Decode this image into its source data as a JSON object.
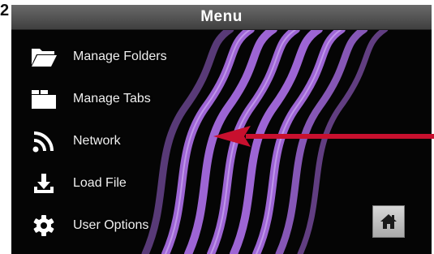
{
  "step_number": "2",
  "window": {
    "title": "Menu"
  },
  "menu": {
    "items": [
      {
        "label": "Manage Folders",
        "icon": "folder-open-icon"
      },
      {
        "label": "Manage Tabs",
        "icon": "tabs-icon"
      },
      {
        "label": "Network",
        "icon": "wifi-icon"
      },
      {
        "label": "Load File",
        "icon": "download-icon"
      },
      {
        "label": "User Options",
        "icon": "gear-icon"
      }
    ]
  },
  "home_button": {
    "icon": "home-icon"
  },
  "annotation": {
    "target": "Network",
    "color": "#c8102e"
  },
  "colors": {
    "background": "#050505",
    "wave": "#a66be0",
    "arrow": "#c8102e"
  }
}
